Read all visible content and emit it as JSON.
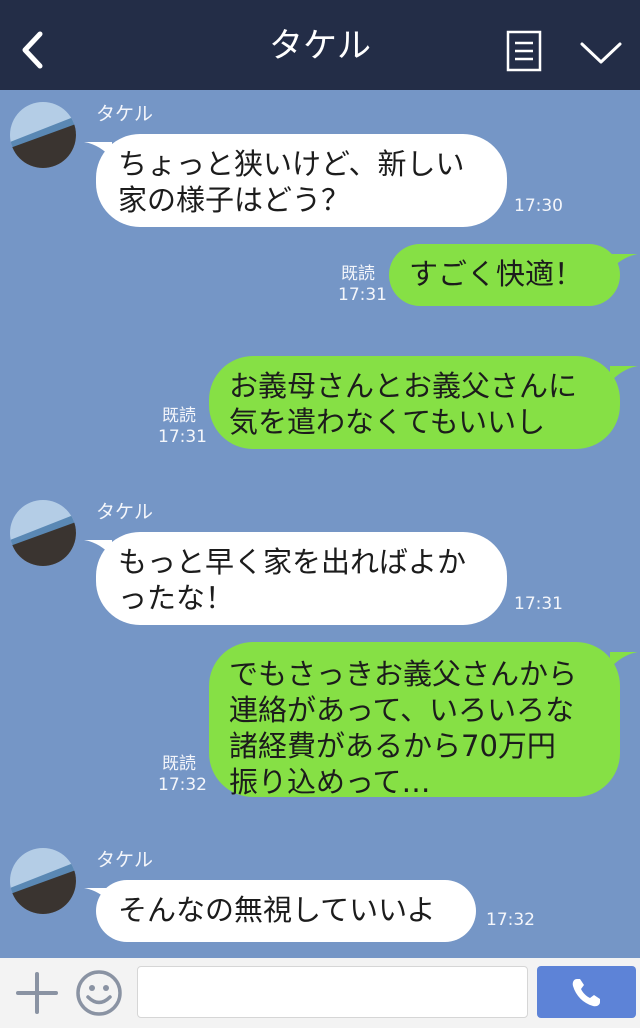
{
  "header": {
    "title": "タケル",
    "back_icon": "chevron-left-icon",
    "memo_icon": "note-icon",
    "menu_icon": "chevron-down-icon"
  },
  "messages": [
    {
      "side": "in",
      "sender": "タケル",
      "text": "ちょっと狭いけど、新しい\n家の様子はどう？",
      "time": "17:30"
    },
    {
      "side": "out",
      "read": "既読",
      "text": "すごく快適！",
      "time": "17:31"
    },
    {
      "side": "out",
      "read": "既読",
      "text": "お義母さんとお義父さんに\n気を遣わなくてもいいし",
      "time": "17:31"
    },
    {
      "side": "in",
      "sender": "タケル",
      "text": "もっと早く家を出ればよか\nったな！",
      "time": "17:31"
    },
    {
      "side": "out",
      "read": "既読",
      "text": "でもさっきお義父さんから\n連絡があって、いろいろな\n諸経費があるから70万円\n振り込めって…",
      "time": "17:32"
    },
    {
      "side": "in",
      "sender": "タケル",
      "text": "そんなの無視していいよ",
      "time": "17:32"
    }
  ],
  "footer": {
    "plus_icon": "plus-icon",
    "sticker_icon": "smiley-icon",
    "message_input_value": "",
    "call_icon": "phone-icon"
  },
  "colors": {
    "header_bg": "#232d47",
    "chat_bg": "#7596c6",
    "incoming_bubble": "#ffffff",
    "outgoing_bubble": "#86e045",
    "call_button": "#5d83d7"
  }
}
